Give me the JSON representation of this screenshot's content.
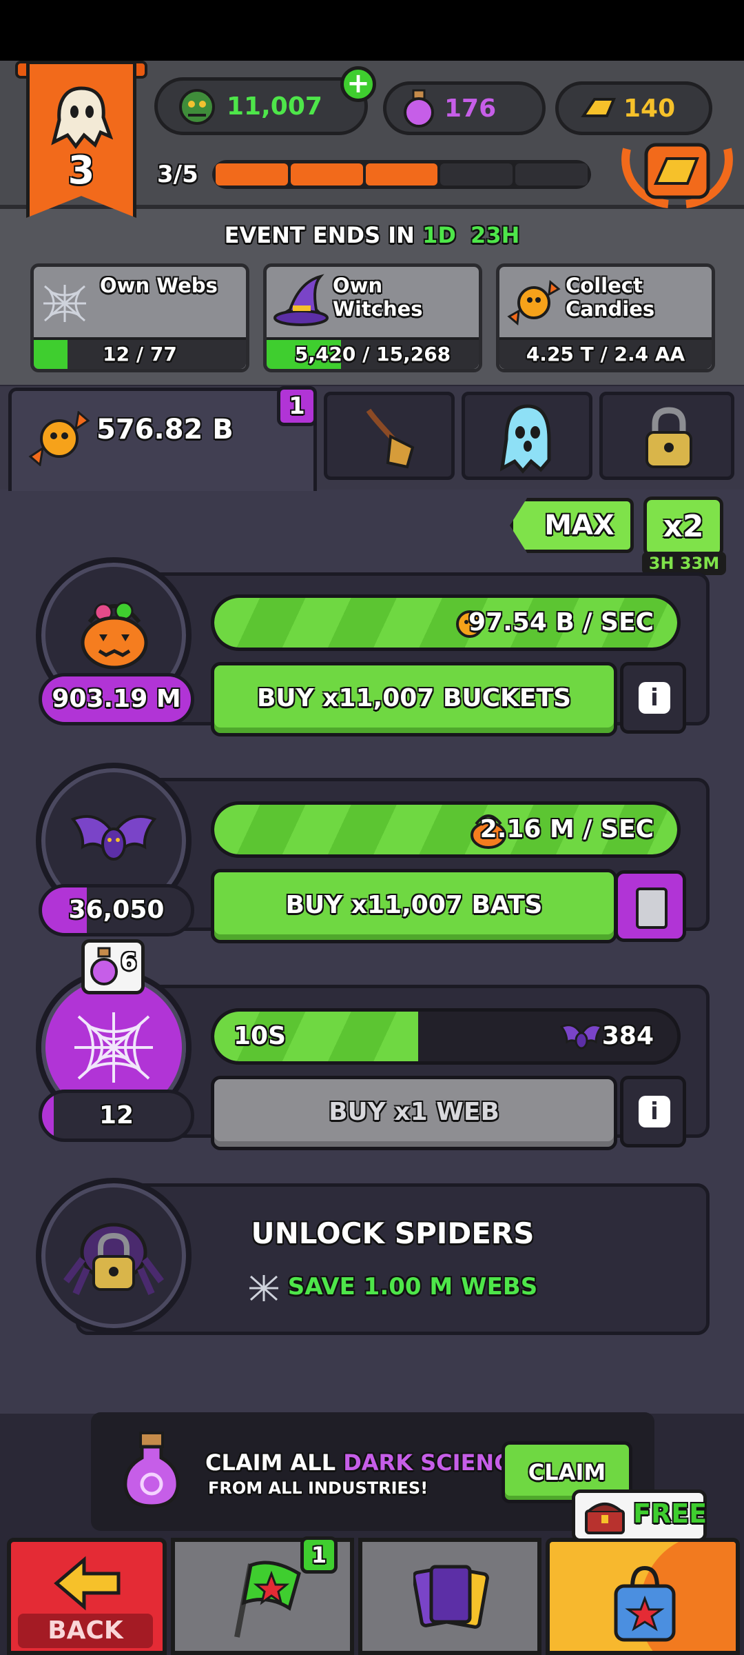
{
  "header": {
    "level": "3",
    "currencies": {
      "orcs": "11,007",
      "dark_science": "176",
      "gold": "140"
    },
    "level_progress_text": "3/5",
    "level_progress": {
      "current": 3,
      "total": 5,
      "fraction": 0.6
    }
  },
  "event": {
    "label": "EVENT ENDS IN",
    "days": "1D",
    "hours": "23H",
    "tasks": [
      {
        "title": "Own Webs",
        "value": "12 / 77",
        "progress": 0.16,
        "icon": "web-icon"
      },
      {
        "title": "Own Witches",
        "value": "5,420 / 15,268",
        "progress": 0.35,
        "icon": "witch-hat-icon"
      },
      {
        "title_line1": "Collect",
        "title_line2": "Candies",
        "value": "4.25 T / 2.4 AA",
        "progress": 0.0,
        "icon": "candy-icon"
      }
    ]
  },
  "tabs": {
    "active_amount": "576.82 B",
    "badge": "1",
    "icons": [
      "candy-icon",
      "broom-icon",
      "ghost-icon",
      "padlock-icon"
    ]
  },
  "multiplier": {
    "max_label": "MAX",
    "boost_label": "x2",
    "boost_time": "3H 33M"
  },
  "industries": [
    {
      "name": "buckets",
      "count": "903.19 M",
      "count_fill": 1.0,
      "rate": "97.54 B / SEC",
      "rate_fill": 1.0,
      "buy_label": "BUY x11,007 BUCKETS",
      "icon": "pumpkin-bucket-icon"
    },
    {
      "name": "bats",
      "count": "36,050",
      "count_fill": 0.3,
      "rate": "2.16 M / SEC",
      "rate_fill": 1.0,
      "buy_label": "BUY x11,007 BATS",
      "icon": "bat-icon"
    },
    {
      "name": "webs",
      "count": "12",
      "count_fill": 0.08,
      "timer": "10S",
      "yield": "384",
      "rate_fill": 0.44,
      "buy_label": "BUY x1 WEB",
      "cost_badge": "6",
      "icon": "web-icon"
    }
  ],
  "unlock": {
    "title": "UNLOCK SPIDERS",
    "save": "SAVE 1.00 M WEBS"
  },
  "claim": {
    "line1_a": "CLAIM ALL",
    "line1_b": "DARK SCIENCE",
    "line2": "FROM ALL INDUSTRIES!",
    "button": "CLAIM"
  },
  "nav": {
    "back": "BACK",
    "mission_badge": "1",
    "free": "FREE"
  },
  "colors": {
    "green": "#6fd842",
    "purple": "#b134d6",
    "orange": "#f26a1b"
  }
}
